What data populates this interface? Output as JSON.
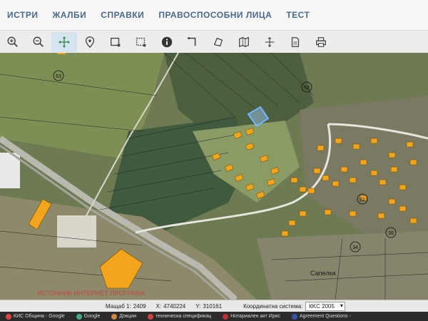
{
  "menu": {
    "items": [
      "ИСТРИ",
      "ЖАЛБИ",
      "СПРАВКИ",
      "ПРАВОСПОСОБНИ ЛИЦА",
      "ТЕСТ"
    ]
  },
  "toolbar": {
    "icons": [
      "zoom-in-icon",
      "zoom-out-icon",
      "pan-icon",
      "location-pin-icon",
      "select-rectangle-icon",
      "select-area-icon",
      "info-icon",
      "measure-line-icon",
      "measure-polygon-icon",
      "map-layers-icon",
      "move-icon",
      "document-icon",
      "print-icon"
    ]
  },
  "map": {
    "parcel_labels": [
      "63",
      "82",
      "53",
      "38",
      "34"
    ],
    "place_label": "Сапелка",
    "red_text": "ИСТОЧНИК ИНТЕРНЕТ ПРОГРАМА"
  },
  "status": {
    "scale_label": "Мащаб 1:",
    "scale_value": "2409",
    "x_label": "X:",
    "x_value": "4740224",
    "y_label": "Y:",
    "y_value": "310161",
    "coord_system_label": "Координатна система:",
    "coord_system_value": "КKC 2005"
  },
  "taskbar": {
    "items": [
      "КИС Община - Google",
      "Google",
      "Докции",
      "техническа спецификац",
      "Нотариален акт Ирис",
      "Agreement Questions -"
    ]
  },
  "colors": {
    "menu_text": "#4a6a8c",
    "parcel_highlight": "#6fb6ff",
    "building_fill": "#f2a51c"
  }
}
